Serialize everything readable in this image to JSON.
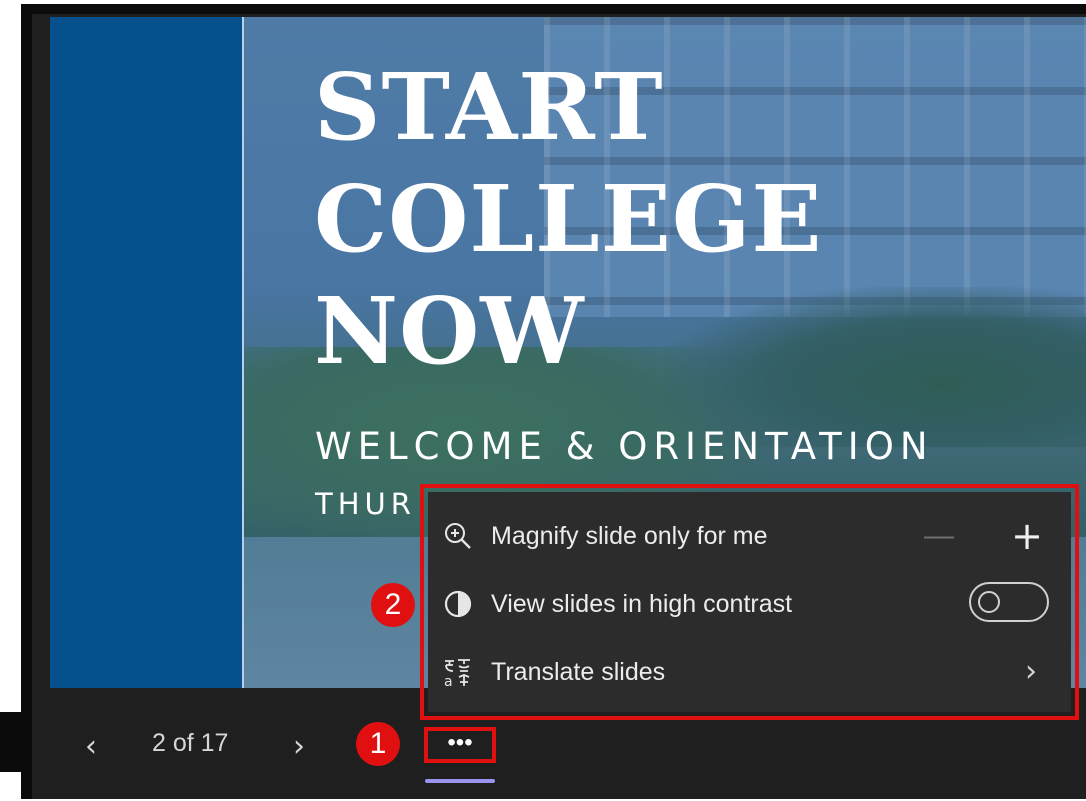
{
  "slide": {
    "title_lines": [
      "START",
      "COLLEGE",
      "NOW"
    ],
    "subtitle": "WELCOME & ORIENTATION",
    "subtitle2_partial": "THUR"
  },
  "controls": {
    "prev_icon": "chevron-left-icon",
    "next_icon": "chevron-right-icon",
    "prev_glyph": "‹",
    "next_glyph": "›",
    "page_indicator": "2 of 17",
    "more_glyph": "•••"
  },
  "menu": {
    "magnify": {
      "label": "Magnify slide only for me",
      "icon": "zoom-in-icon",
      "minus": "—",
      "plus": "+"
    },
    "contrast": {
      "label": "View slides in high contrast",
      "icon": "contrast-icon",
      "toggle_on": false
    },
    "translate": {
      "label": "Translate slides",
      "icon": "translate-icon",
      "chevron": "›"
    }
  },
  "annotations": {
    "badge_1": "1",
    "badge_2": "2",
    "highlight_color": "#e01010"
  },
  "colors": {
    "accent_underline": "#9b93f0",
    "slide_blue": "#06508e"
  }
}
